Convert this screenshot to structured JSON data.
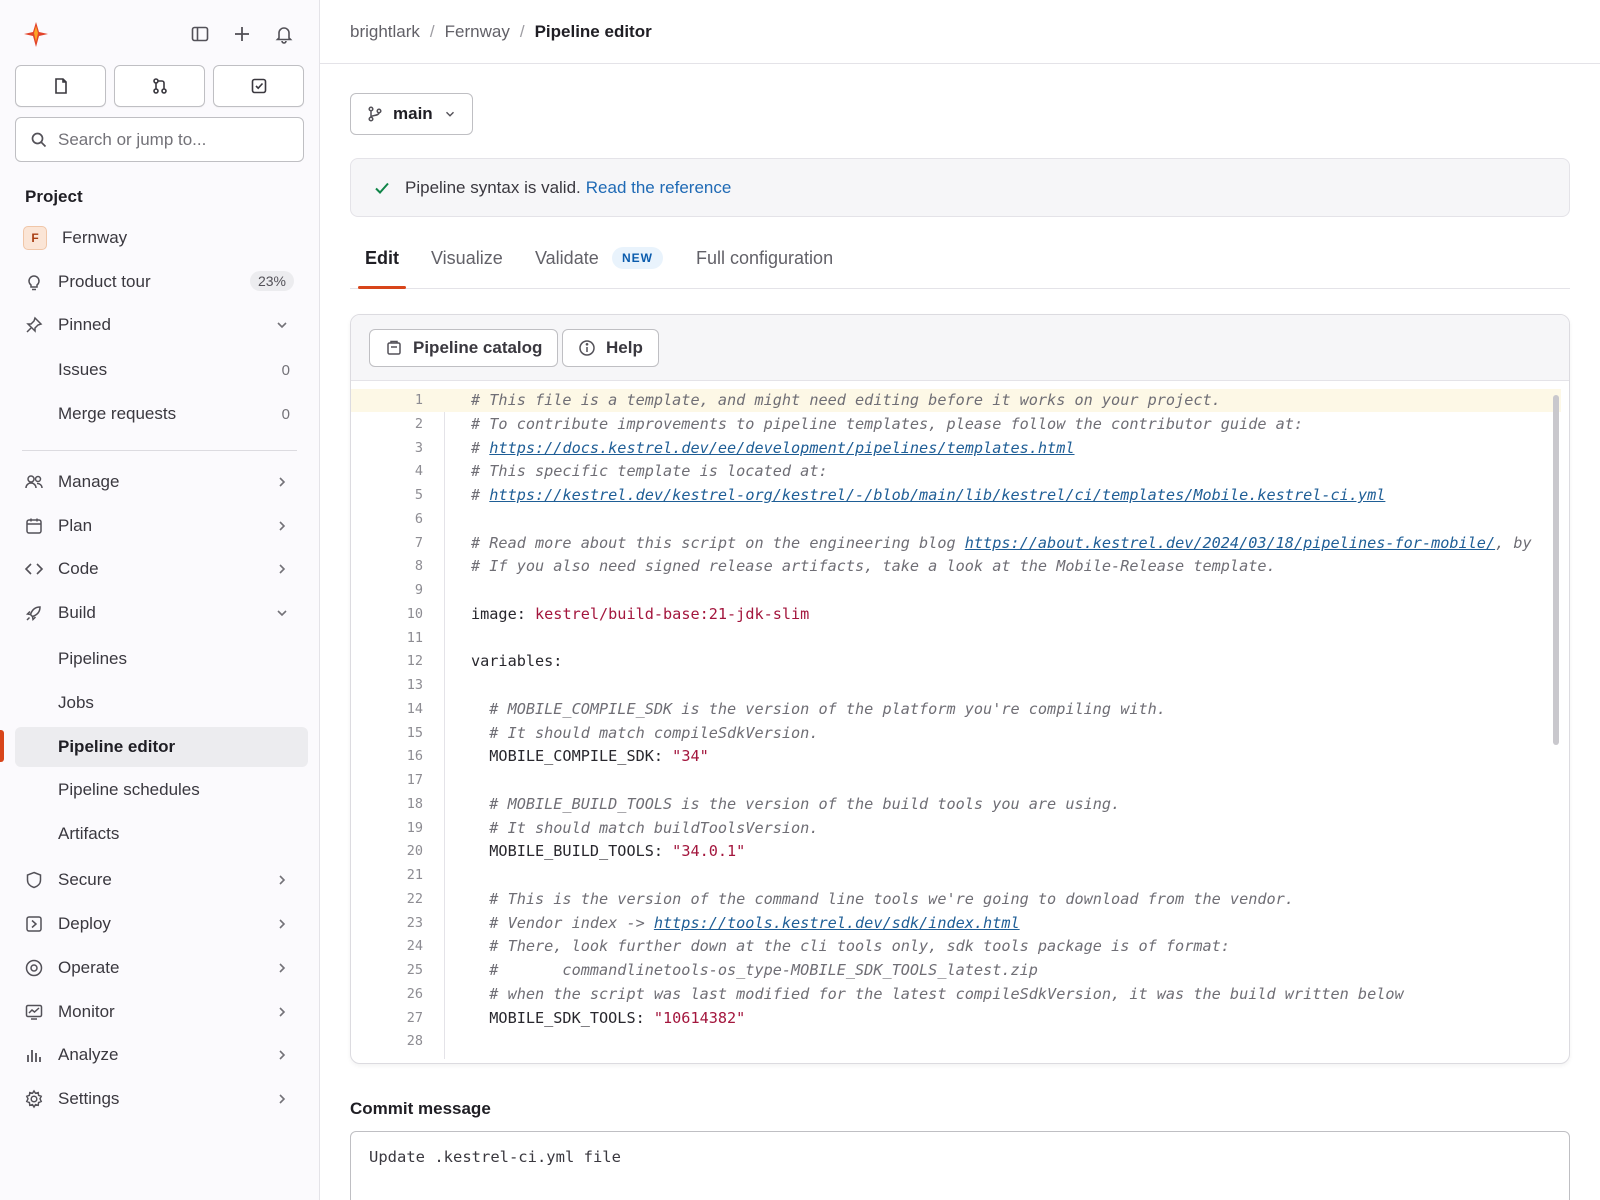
{
  "sidebar": {
    "search_placeholder": "Search or jump to...",
    "section_title": "Project",
    "project": {
      "avatar_letter": "F",
      "name": "Fernway"
    },
    "product_tour": {
      "label": "Product tour",
      "badge": "23%"
    },
    "pinned": {
      "label": "Pinned",
      "items": [
        {
          "label": "Issues",
          "count": "0"
        },
        {
          "label": "Merge requests",
          "count": "0"
        }
      ]
    },
    "groups": [
      {
        "label": "Manage",
        "icon": "users-icon"
      },
      {
        "label": "Plan",
        "icon": "calendar-icon"
      },
      {
        "label": "Code",
        "icon": "code-icon"
      },
      {
        "label": "Build",
        "icon": "rocket-icon",
        "expanded": true
      }
    ],
    "build_items": [
      "Pipelines",
      "Jobs",
      "Pipeline editor",
      "Pipeline schedules",
      "Artifacts"
    ],
    "active_item": "Pipeline editor",
    "groups_after": [
      {
        "label": "Secure",
        "icon": "shield-icon"
      },
      {
        "label": "Deploy",
        "icon": "deploy-icon"
      },
      {
        "label": "Operate",
        "icon": "operate-icon"
      },
      {
        "label": "Monitor",
        "icon": "monitor-icon"
      },
      {
        "label": "Analyze",
        "icon": "chart-icon"
      },
      {
        "label": "Settings",
        "icon": "gear-icon"
      }
    ]
  },
  "breadcrumb": {
    "items": [
      "brightlark",
      "Fernway"
    ],
    "current": "Pipeline editor"
  },
  "branch": {
    "name": "main"
  },
  "alert": {
    "message": "Pipeline syntax is valid.",
    "link": "Read the reference"
  },
  "tabs": [
    {
      "label": "Edit",
      "active": true
    },
    {
      "label": "Visualize"
    },
    {
      "label": "Validate",
      "badge": "NEW"
    },
    {
      "label": "Full configuration"
    }
  ],
  "editor_toolbar": {
    "catalog": "Pipeline catalog",
    "help": "Help"
  },
  "code_lines": [
    {
      "n": "1",
      "parts": [
        {
          "t": "# This file is a template, and might need editing before it works on your project.",
          "c": "cm"
        }
      ]
    },
    {
      "n": "2",
      "parts": [
        {
          "t": "# To contribute improvements to pipeline templates, please follow the contributor guide at:",
          "c": "cm"
        }
      ]
    },
    {
      "n": "3",
      "parts": [
        {
          "t": "# ",
          "c": "cm"
        },
        {
          "t": "https://docs.kestrel.dev/ee/development/pipelines/templates.html",
          "c": "url"
        }
      ]
    },
    {
      "n": "4",
      "parts": [
        {
          "t": "# This specific template is located at:",
          "c": "cm"
        }
      ]
    },
    {
      "n": "5",
      "parts": [
        {
          "t": "# ",
          "c": "cm"
        },
        {
          "t": "https://kestrel.dev/kestrel-org/kestrel/-/blob/main/lib/kestrel/ci/templates/Mobile.kestrel-ci.yml",
          "c": "url"
        }
      ]
    },
    {
      "n": "6",
      "parts": []
    },
    {
      "n": "7",
      "parts": [
        {
          "t": "# Read more about this script on the engineering blog ",
          "c": "cm"
        },
        {
          "t": "https://about.kestrel.dev/2024/03/18/pipelines-for-mobile/",
          "c": "url"
        },
        {
          "t": ", by",
          "c": "cm"
        }
      ]
    },
    {
      "n": "8",
      "parts": [
        {
          "t": "# If you also need signed release artifacts, take a look at the Mobile-Release template.",
          "c": "cm"
        }
      ]
    },
    {
      "n": "9",
      "parts": []
    },
    {
      "n": "10",
      "parts": [
        {
          "t": "image: ",
          "c": "key"
        },
        {
          "t": "kestrel/build-base:21-jdk-slim",
          "c": "str"
        }
      ]
    },
    {
      "n": "11",
      "parts": []
    },
    {
      "n": "12",
      "parts": [
        {
          "t": "variables:",
          "c": "key"
        }
      ]
    },
    {
      "n": "13",
      "parts": []
    },
    {
      "n": "14",
      "parts": [
        {
          "t": "  # MOBILE_COMPILE_SDK is the version of the platform you're compiling with.",
          "c": "cm"
        }
      ]
    },
    {
      "n": "15",
      "parts": [
        {
          "t": "  # It should match compileSdkVersion.",
          "c": "cm"
        }
      ]
    },
    {
      "n": "16",
      "parts": [
        {
          "t": "  MOBILE_COMPILE_SDK: ",
          "c": "key"
        },
        {
          "t": "\"34\"",
          "c": "str"
        }
      ]
    },
    {
      "n": "17",
      "parts": []
    },
    {
      "n": "18",
      "parts": [
        {
          "t": "  # MOBILE_BUILD_TOOLS is the version of the build tools you are using.",
          "c": "cm"
        }
      ]
    },
    {
      "n": "19",
      "parts": [
        {
          "t": "  # It should match buildToolsVersion.",
          "c": "cm"
        }
      ]
    },
    {
      "n": "20",
      "parts": [
        {
          "t": "  MOBILE_BUILD_TOOLS: ",
          "c": "key"
        },
        {
          "t": "\"34.0.1\"",
          "c": "str"
        }
      ]
    },
    {
      "n": "21",
      "parts": []
    },
    {
      "n": "22",
      "parts": [
        {
          "t": "  # This is the version of the command line tools we're going to download from the vendor.",
          "c": "cm"
        }
      ]
    },
    {
      "n": "23",
      "parts": [
        {
          "t": "  # Vendor index -> ",
          "c": "cm"
        },
        {
          "t": "https://tools.kestrel.dev/sdk/index.html",
          "c": "url"
        }
      ]
    },
    {
      "n": "24",
      "parts": [
        {
          "t": "  # There, look further down at the cli tools only, sdk tools package is of format:",
          "c": "cm"
        }
      ]
    },
    {
      "n": "25",
      "parts": [
        {
          "t": "  #       commandlinetools-os_type-MOBILE_SDK_TOOLS_latest.zip",
          "c": "cm"
        }
      ]
    },
    {
      "n": "26",
      "parts": [
        {
          "t": "  # when the script was last modified for the latest compileSdkVersion, it was the build written below",
          "c": "cm"
        }
      ]
    },
    {
      "n": "27",
      "parts": [
        {
          "t": "  MOBILE_SDK_TOOLS: ",
          "c": "key"
        },
        {
          "t": "\"10614382\"",
          "c": "str"
        }
      ]
    },
    {
      "n": "28",
      "parts": []
    }
  ],
  "commit": {
    "title": "Commit message",
    "value": "Update .kestrel-ci.yml file"
  }
}
